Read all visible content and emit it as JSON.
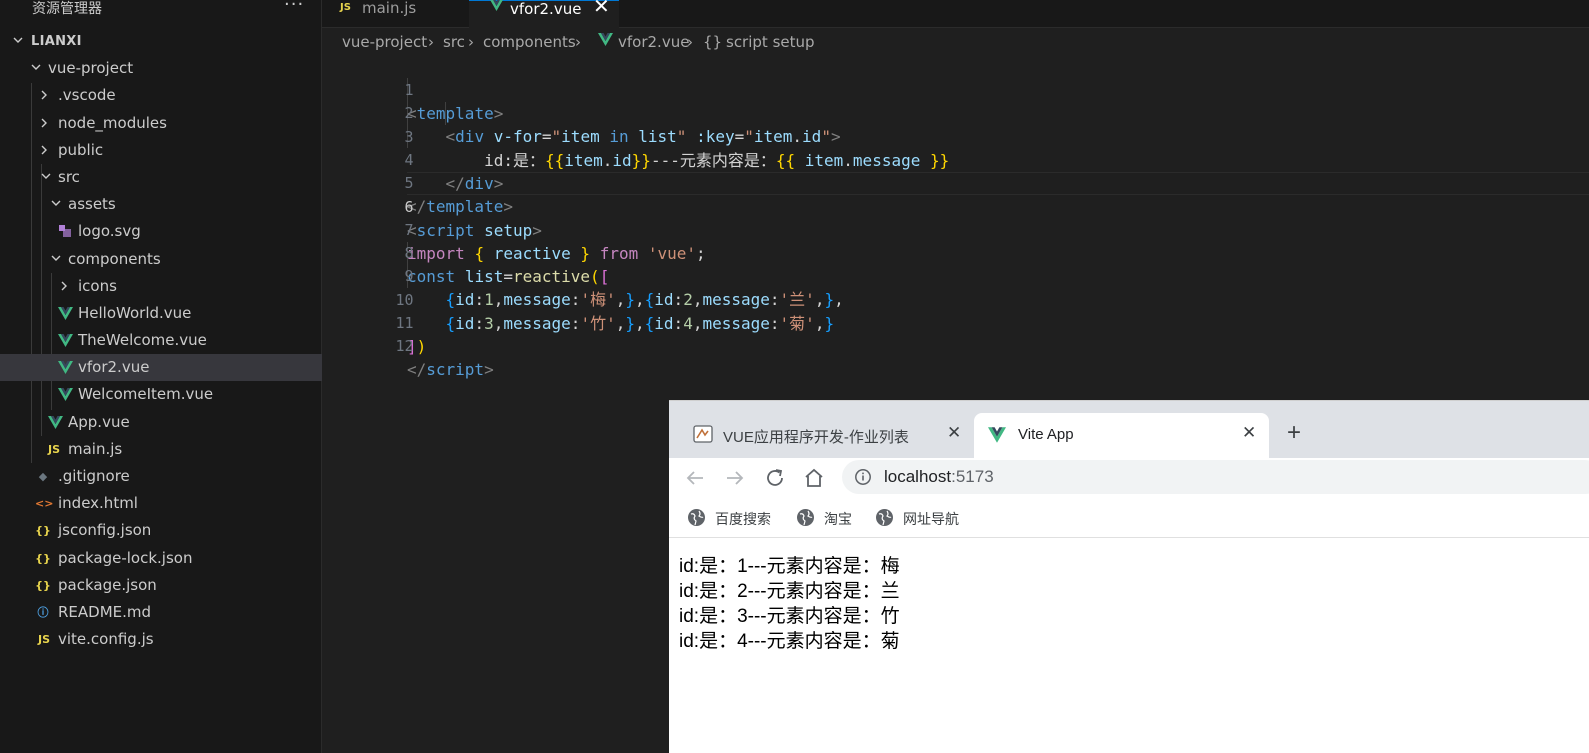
{
  "explorer": {
    "title": "资源管理器",
    "more": "···",
    "root": "LIANXI",
    "items": [
      {
        "label": "vue-project"
      },
      {
        "label": ".vscode"
      },
      {
        "label": "node_modules"
      },
      {
        "label": "public"
      },
      {
        "label": "src"
      },
      {
        "label": "assets"
      },
      {
        "label": "logo.svg"
      },
      {
        "label": "components"
      },
      {
        "label": "icons"
      },
      {
        "label": "HelloWorld.vue"
      },
      {
        "label": "TheWelcome.vue"
      },
      {
        "label": "vfor2.vue"
      },
      {
        "label": "WelcomeItem.vue"
      },
      {
        "label": "App.vue"
      },
      {
        "label": "main.js"
      },
      {
        "label": ".gitignore"
      },
      {
        "label": "index.html"
      },
      {
        "label": "jsconfig.json"
      },
      {
        "label": "package-lock.json"
      },
      {
        "label": "package.json"
      },
      {
        "label": "README.md"
      },
      {
        "label": "vite.config.js"
      }
    ],
    "icon_text": {
      "js": "JS",
      "json": "{}",
      "html": "<>",
      "info": "ⓘ",
      "git": "◆"
    }
  },
  "tabs": [
    {
      "label": "main.js",
      "icon": "JS"
    },
    {
      "label": "vfor2.vue",
      "close": "✕"
    }
  ],
  "breadcrumb": {
    "parts": [
      "vue-project",
      "src",
      "components",
      "vfor2.vue",
      "script setup"
    ],
    "sep": "›",
    "braces": "{}"
  },
  "editor": {
    "line_numbers": [
      "1",
      "2",
      "3",
      "4",
      "5",
      "6",
      "7",
      "8",
      "9",
      "10",
      "11",
      "12"
    ],
    "current_line": 6
  },
  "browser": {
    "tabs": [
      {
        "label": "VUE应用程序开发-作业列表",
        "close": "✕"
      },
      {
        "label": "Vite App",
        "close": "✕"
      }
    ],
    "new_tab": "+",
    "address": {
      "host": "localhost",
      "port": ":5173"
    },
    "bookmarks": [
      "百度搜索",
      "淘宝",
      "网址导航"
    ],
    "content_lines": [
      "id:是：1---元素内容是：梅",
      "id:是：2---元素内容是：兰",
      "id:是：3---元素内容是：竹",
      "id:是：4---元素内容是：菊"
    ]
  },
  "colors": {
    "vue_green": "#41b883",
    "vue_dark": "#35495e",
    "accent": "#0078d4"
  }
}
